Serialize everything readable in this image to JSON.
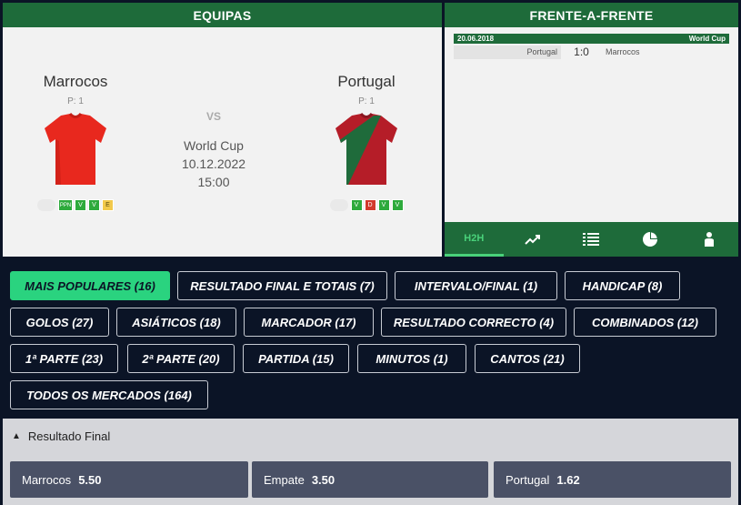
{
  "teams_panel": {
    "header": "EQUIPAS",
    "home": {
      "name": "Marrocos",
      "position": "P: 1",
      "form": [
        "PPN",
        "V",
        "V",
        "E"
      ]
    },
    "away": {
      "name": "Portugal",
      "position": "P: 1",
      "form": [
        "V",
        "D",
        "V",
        "V"
      ]
    },
    "vs": "VS",
    "competition": "World Cup",
    "date": "10.12.2022",
    "time": "15:00"
  },
  "h2h_panel": {
    "header": "FRENTE-A-FRENTE",
    "matches": [
      {
        "date": "20.06.2018",
        "competition": "World Cup",
        "home": "Portugal",
        "score": "1:0",
        "away": "Marrocos"
      }
    ],
    "tabs": [
      {
        "label": "H2H",
        "icon": ""
      },
      {
        "label": "",
        "icon": "trend-icon"
      },
      {
        "label": "",
        "icon": "list-icon"
      },
      {
        "label": "",
        "icon": "pie-chart-icon"
      },
      {
        "label": "",
        "icon": "player-icon"
      }
    ]
  },
  "market_chips": [
    "MAIS POPULARES (16)",
    "RESULTADO FINAL E TOTAIS (7)",
    "INTERVALO/FINAL (1)",
    "HANDICAP (8)",
    "GOLOS (27)",
    "ASIÁTICOS (18)",
    "MARCADOR (17)",
    "RESULTADO CORRECTO (4)",
    "COMBINADOS (12)",
    "1ª PARTE (23)",
    "2ª PARTE (20)",
    "PARTIDA (15)",
    "MINUTOS (1)",
    "CANTOS (21)",
    "TODOS OS MERCADOS (164)"
  ],
  "result_section": {
    "title": "Resultado Final",
    "odds": [
      {
        "label": "Marrocos",
        "value": "5.50"
      },
      {
        "label": "Empate",
        "value": "3.50"
      },
      {
        "label": "Portugal",
        "value": "1.62"
      }
    ]
  },
  "colors": {
    "header_green": "#1e6b3a",
    "accent_green": "#2ad37f",
    "background": "#0b1426",
    "odd_button": "#4a5166"
  }
}
